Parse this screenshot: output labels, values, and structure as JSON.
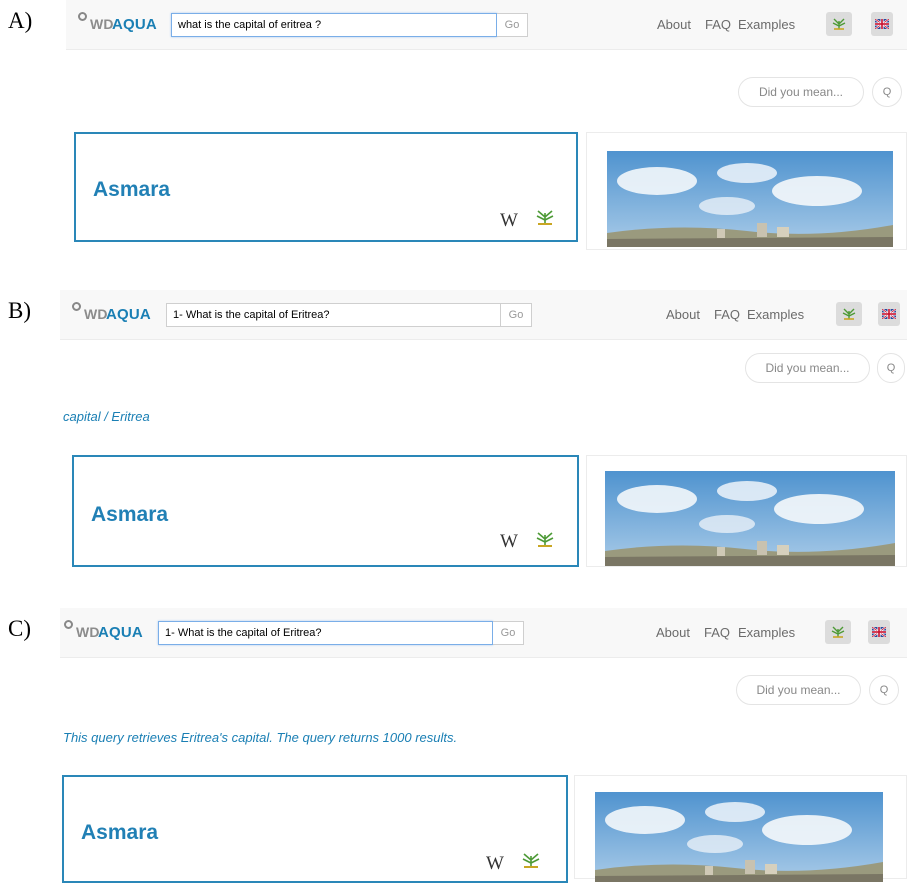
{
  "panels": [
    {
      "letter": "A)",
      "app": {
        "logo_prefix": "WD",
        "logo_suffix": "AQUA"
      },
      "search": {
        "value": "what is the capital of eritrea ?",
        "go_label": "Go"
      },
      "nav": {
        "about": "About",
        "faq": "FAQ",
        "examples": "Examples"
      },
      "did_you_mean": "Did you mean...",
      "q_label": "Q",
      "interpretation": "",
      "answer": {
        "label": "Asmara",
        "wikipedia_glyph": "W"
      }
    },
    {
      "letter": "B)",
      "app": {
        "logo_prefix": "WD",
        "logo_suffix": "AQUA"
      },
      "search": {
        "value": "1- What is the capital of Eritrea?",
        "go_label": "Go"
      },
      "nav": {
        "about": "About",
        "faq": "FAQ",
        "examples": "Examples"
      },
      "did_you_mean": "Did you mean...",
      "q_label": "Q",
      "interpretation": "capital / Eritrea",
      "answer": {
        "label": "Asmara",
        "wikipedia_glyph": "W"
      }
    },
    {
      "letter": "C)",
      "app": {
        "logo_prefix": "WD",
        "logo_suffix": "AQUA"
      },
      "search": {
        "value": "1- What is the capital of Eritrea?",
        "go_label": "Go"
      },
      "nav": {
        "about": "About",
        "faq": "FAQ",
        "examples": "Examples"
      },
      "did_you_mean": "Did you mean...",
      "q_label": "Q",
      "interpretation": "This query retrieves Eritrea's capital. The query returns 1000 results.",
      "answer": {
        "label": "Asmara",
        "wikipedia_glyph": "W"
      }
    }
  ],
  "colors": {
    "accent": "#2180b5",
    "navbar_bg": "#f8f8f8",
    "logo_grey": "#8c8c8c"
  },
  "icons": [
    "wikidata-icon",
    "uk-flag-icon",
    "search-icon"
  ]
}
